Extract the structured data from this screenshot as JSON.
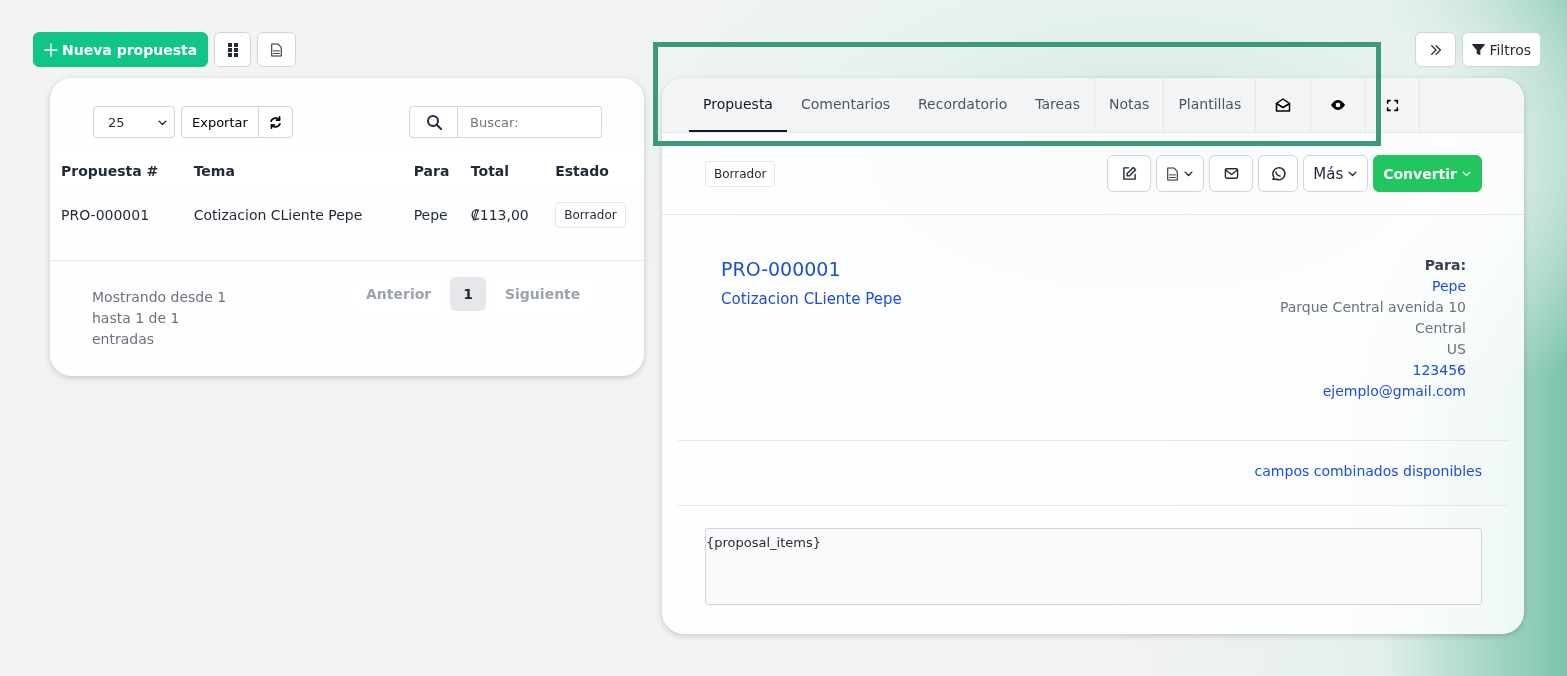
{
  "toolbar": {
    "new_button": "Nueva propuesta"
  },
  "top_right": {
    "filters_button": "Filtros"
  },
  "list": {
    "page_size": "25",
    "export_button": "Exportar",
    "search": {
      "placeholder": "Buscar:"
    },
    "columns": [
      "Propuesta #",
      "Tema",
      "Para",
      "Total",
      "Estado"
    ],
    "rows": [
      {
        "number": "PRO-000001",
        "subject": "Cotizacion CLiente Pepe",
        "to": "Pepe",
        "total": "₡113,00",
        "status": "Borrador"
      }
    ],
    "info": "Mostrando desde 1 hasta 1 de 1 entradas",
    "pagination": [
      {
        "label": "Anterior",
        "selected": false,
        "disabled": true
      },
      {
        "label": "1",
        "selected": true,
        "disabled": false
      },
      {
        "label": "Siguiente",
        "selected": false,
        "disabled": true
      }
    ]
  },
  "detail": {
    "tabs": [
      {
        "label": "Propuesta",
        "selected": true
      },
      {
        "label": "Comentarios",
        "selected": false
      },
      {
        "label": "Recordatorio",
        "selected": false
      },
      {
        "label": "Tareas",
        "selected": false
      },
      {
        "label": "Notas",
        "selected": false
      },
      {
        "label": "Plantillas",
        "selected": false
      }
    ],
    "status": "Borrador",
    "more_button": "Más",
    "convert_button": "Convertir",
    "number": "PRO-000001",
    "subject": "Cotizacion CLiente Pepe",
    "to_label": "Para:",
    "to_name": "Pepe",
    "address_lines": [
      "Parque Central avenida 10",
      "Central",
      "US"
    ],
    "phone": "123456",
    "email": "ejemplo@gmail.com",
    "merge_fields_link": "campos combinados disponibles",
    "items_text": "{proposal_items}"
  }
}
